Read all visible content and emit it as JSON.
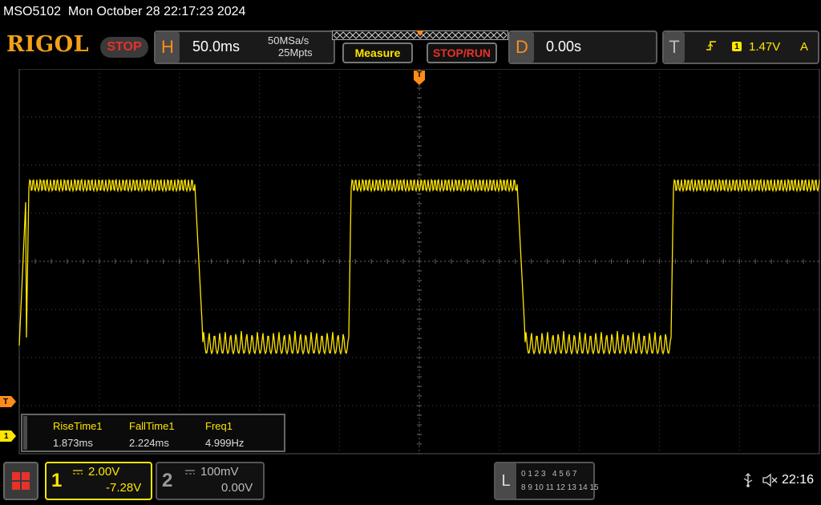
{
  "titlebar": {
    "title": "MSO5102  Mon October 28 22:17:23 2024"
  },
  "toolbar": {
    "logo": "RIGOL",
    "status": "STOP",
    "horizontal": {
      "letter": "H",
      "timebase": "50.0ms",
      "sample_rate": "50MSa/s",
      "memory_depth": "25Mpts"
    },
    "measure_label": "Measure",
    "stoprun_label": "STOP/RUN",
    "delay": {
      "letter": "D",
      "value": "0.00s"
    },
    "trigger": {
      "letter": "T",
      "edge_icon": "rising-edge-icon",
      "source": "1",
      "level": "1.47V",
      "mode": "A"
    }
  },
  "markers": {
    "trigger_position": "T",
    "trigger_level": "T",
    "ch1_ground": "1"
  },
  "measurements": [
    {
      "name": "RiseTime1",
      "value": "1.873ms"
    },
    {
      "name": "FallTime1",
      "value": "2.224ms"
    },
    {
      "name": "Freq1",
      "value": "4.999Hz"
    }
  ],
  "channels": [
    {
      "number": "1",
      "scale": "2.00V",
      "offset": "-7.28V",
      "color": "#ffe600",
      "active": true
    },
    {
      "number": "2",
      "scale": "100mV",
      "offset": "0.00V",
      "color": "#999999",
      "active": false
    }
  ],
  "logic": {
    "letter": "L",
    "row1": "0 1 2 3   4 5 6 7",
    "row2": "8 9 10 11 12 13 14 15"
  },
  "statusbar": {
    "usb_icon": "usb-icon",
    "speaker_icon": "speaker-muted-icon",
    "time": "22:16"
  },
  "colors": {
    "trace": "#ffe600",
    "trigger": "#ff8c1a",
    "accent": "#f2a01a",
    "stop": "#e8312a"
  }
}
